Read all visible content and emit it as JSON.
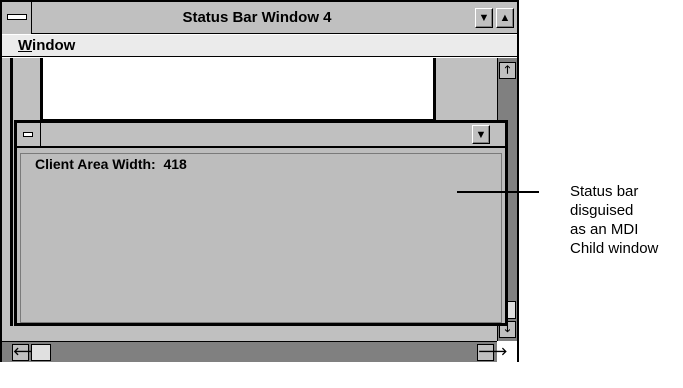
{
  "window": {
    "title": "Status Bar Window 4",
    "menu": [
      {
        "label_first": "W",
        "label_rest": "indow"
      }
    ]
  },
  "status_child": {
    "client_text": "Client Area Width:  418"
  },
  "callout": {
    "lines": [
      "Status bar",
      "disguised",
      "as an MDI",
      "Child window"
    ]
  },
  "icons": {
    "system_menu": "system-menu-icon",
    "minimize": "triangle-down-icon",
    "maximize": "triangle-up-icon",
    "scroll_up": "arrow-up-icon",
    "scroll_down": "arrow-down-icon",
    "scroll_left": "arrow-left-icon",
    "scroll_right": "arrow-right-icon"
  }
}
